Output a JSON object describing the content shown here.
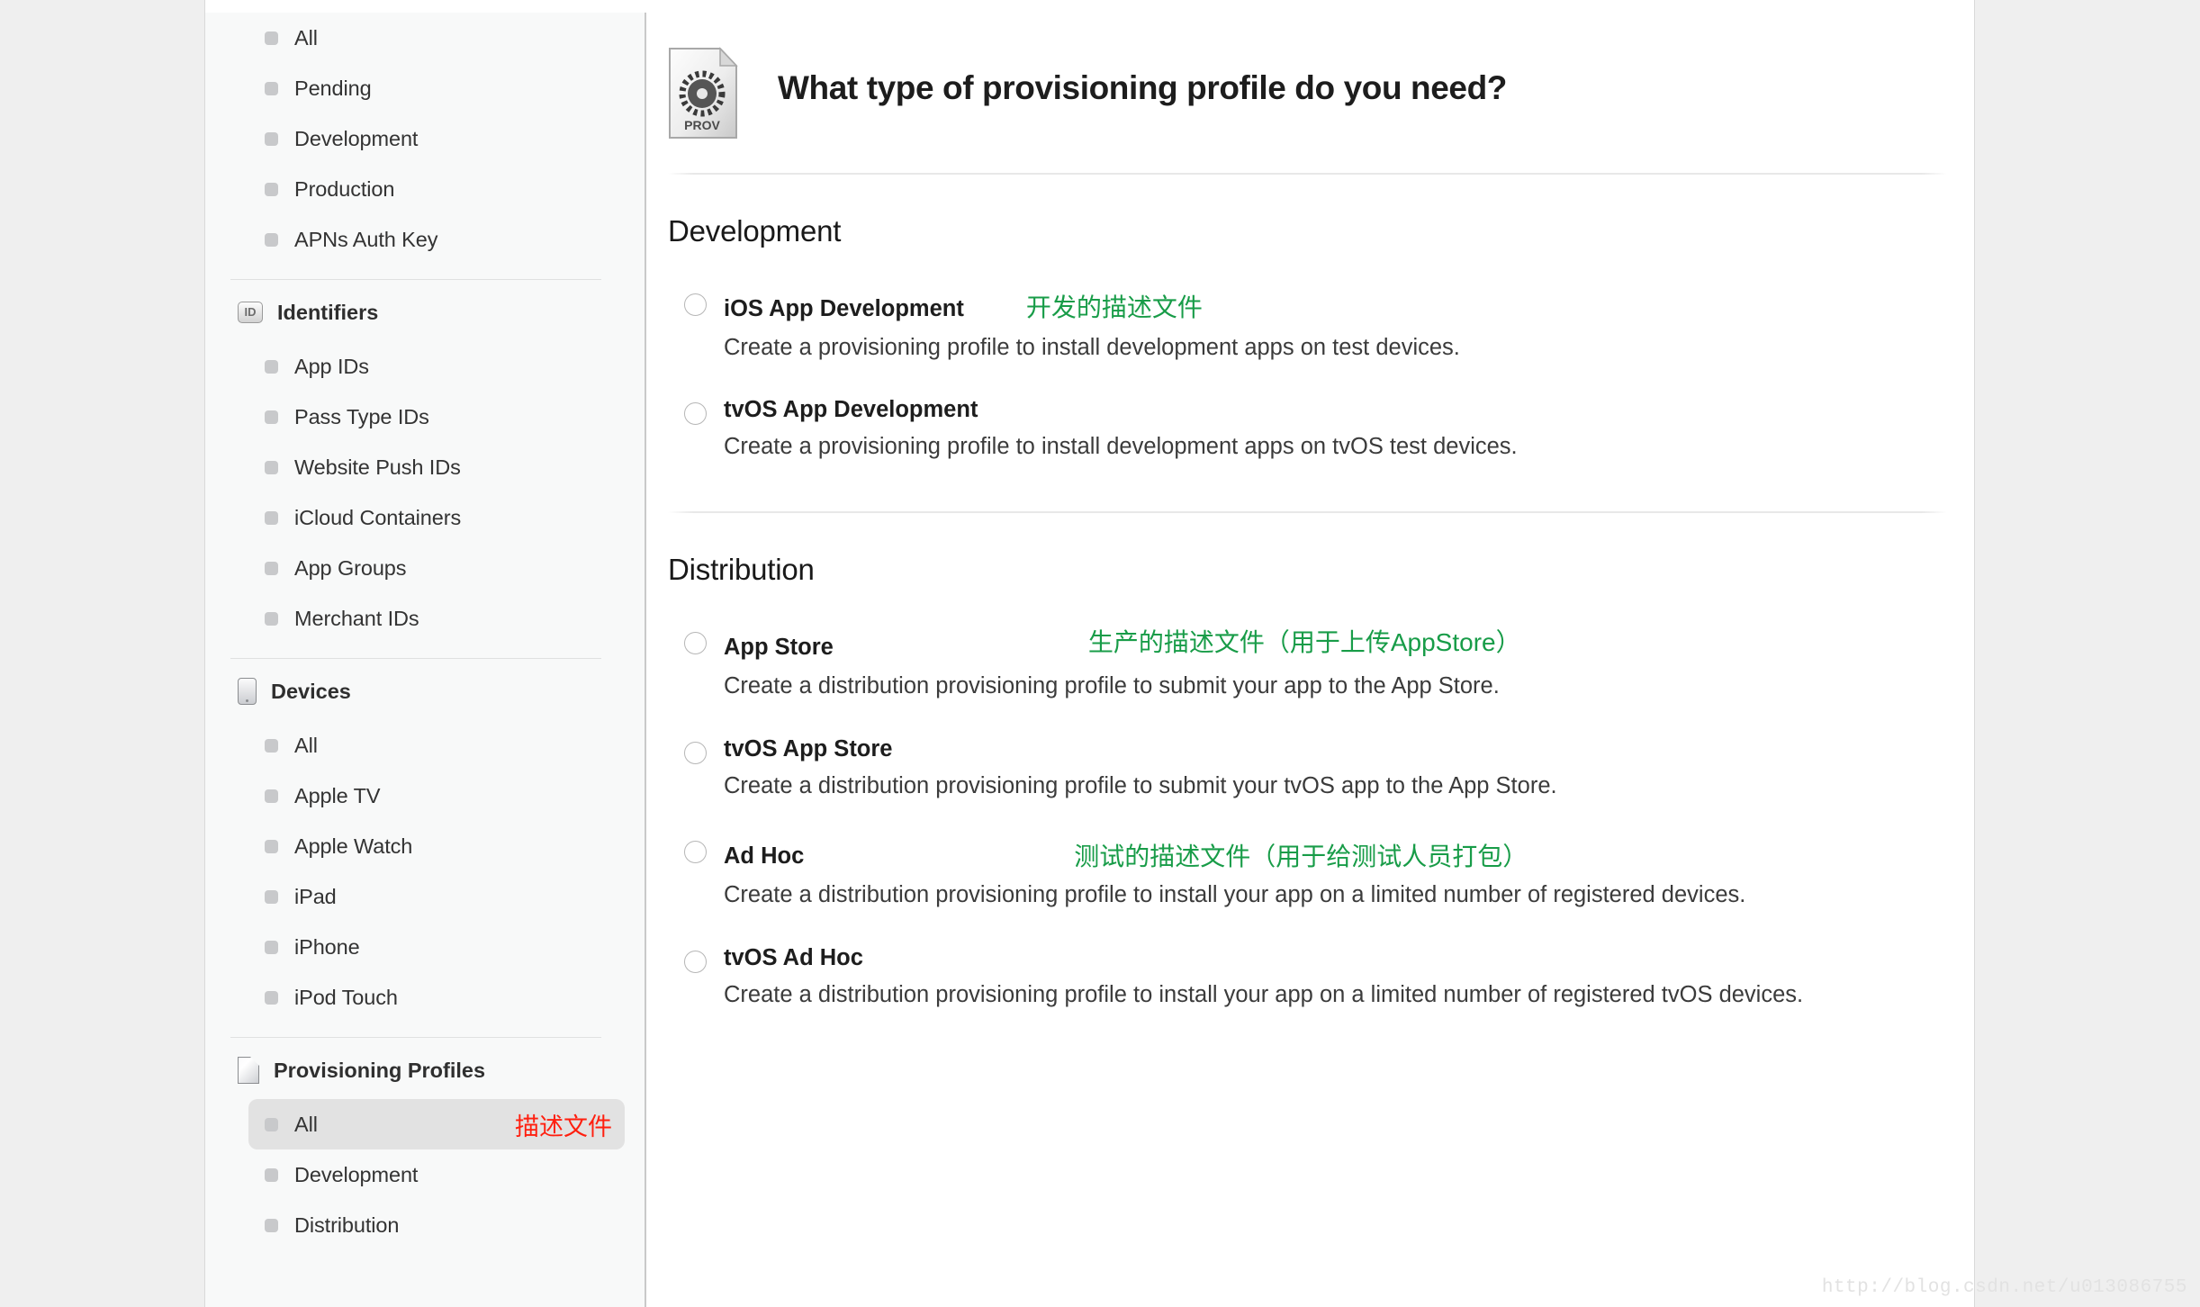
{
  "watermark": "http://blog.csdn.net/u013086755",
  "sidebar": {
    "certificates_items": [
      {
        "label": "All"
      },
      {
        "label": "Pending"
      },
      {
        "label": "Development"
      },
      {
        "label": "Production"
      },
      {
        "label": "APNs Auth Key"
      }
    ],
    "groups": [
      {
        "title": "Identifiers",
        "icon": "id-badge-icon",
        "icon_text": "ID",
        "items": [
          {
            "label": "App IDs"
          },
          {
            "label": "Pass Type IDs"
          },
          {
            "label": "Website Push IDs"
          },
          {
            "label": "iCloud Containers"
          },
          {
            "label": "App Groups"
          },
          {
            "label": "Merchant IDs"
          }
        ]
      },
      {
        "title": "Devices",
        "icon": "device-icon",
        "items": [
          {
            "label": "All"
          },
          {
            "label": "Apple TV"
          },
          {
            "label": "Apple Watch"
          },
          {
            "label": "iPad"
          },
          {
            "label": "iPhone"
          },
          {
            "label": "iPod Touch"
          }
        ]
      },
      {
        "title": "Provisioning Profiles",
        "icon": "document-icon",
        "items": [
          {
            "label": "All",
            "selected": true,
            "annotation": "描述文件"
          },
          {
            "label": "Development"
          },
          {
            "label": "Distribution"
          }
        ]
      }
    ]
  },
  "main": {
    "icon_label": "PROV",
    "title": "What type of provisioning profile do you need?",
    "sections": [
      {
        "heading": "Development",
        "options": [
          {
            "name": "iOS App Development",
            "annotation": "开发的描述文件",
            "description": "Create a provisioning profile to install development apps on test devices."
          },
          {
            "name": "tvOS App Development",
            "annotation": "",
            "description": "Create a provisioning profile to install development apps on tvOS test devices."
          }
        ]
      },
      {
        "heading": "Distribution",
        "options": [
          {
            "name": "App Store",
            "annotation": "生产的描述文件（用于上传AppStore）",
            "description": "Create a distribution provisioning profile to submit your app to the App Store."
          },
          {
            "name": "tvOS App Store",
            "annotation": "",
            "description": "Create a distribution provisioning profile to submit your tvOS app to the App Store."
          },
          {
            "name": "Ad Hoc",
            "annotation": "测试的描述文件（用于给测试人员打包）",
            "description": "Create a distribution provisioning profile to install your app on a limited number of registered devices."
          },
          {
            "name": "tvOS Ad Hoc",
            "annotation": "",
            "description": "Create a distribution provisioning profile to install your app on a limited number of registered tvOS devices."
          }
        ]
      }
    ]
  },
  "colors": {
    "annotation_red": "#ff1f0f",
    "annotation_green": "#189c48",
    "sidebar_bg": "#f8f9f9",
    "selected_row": "#e2e2e2"
  }
}
